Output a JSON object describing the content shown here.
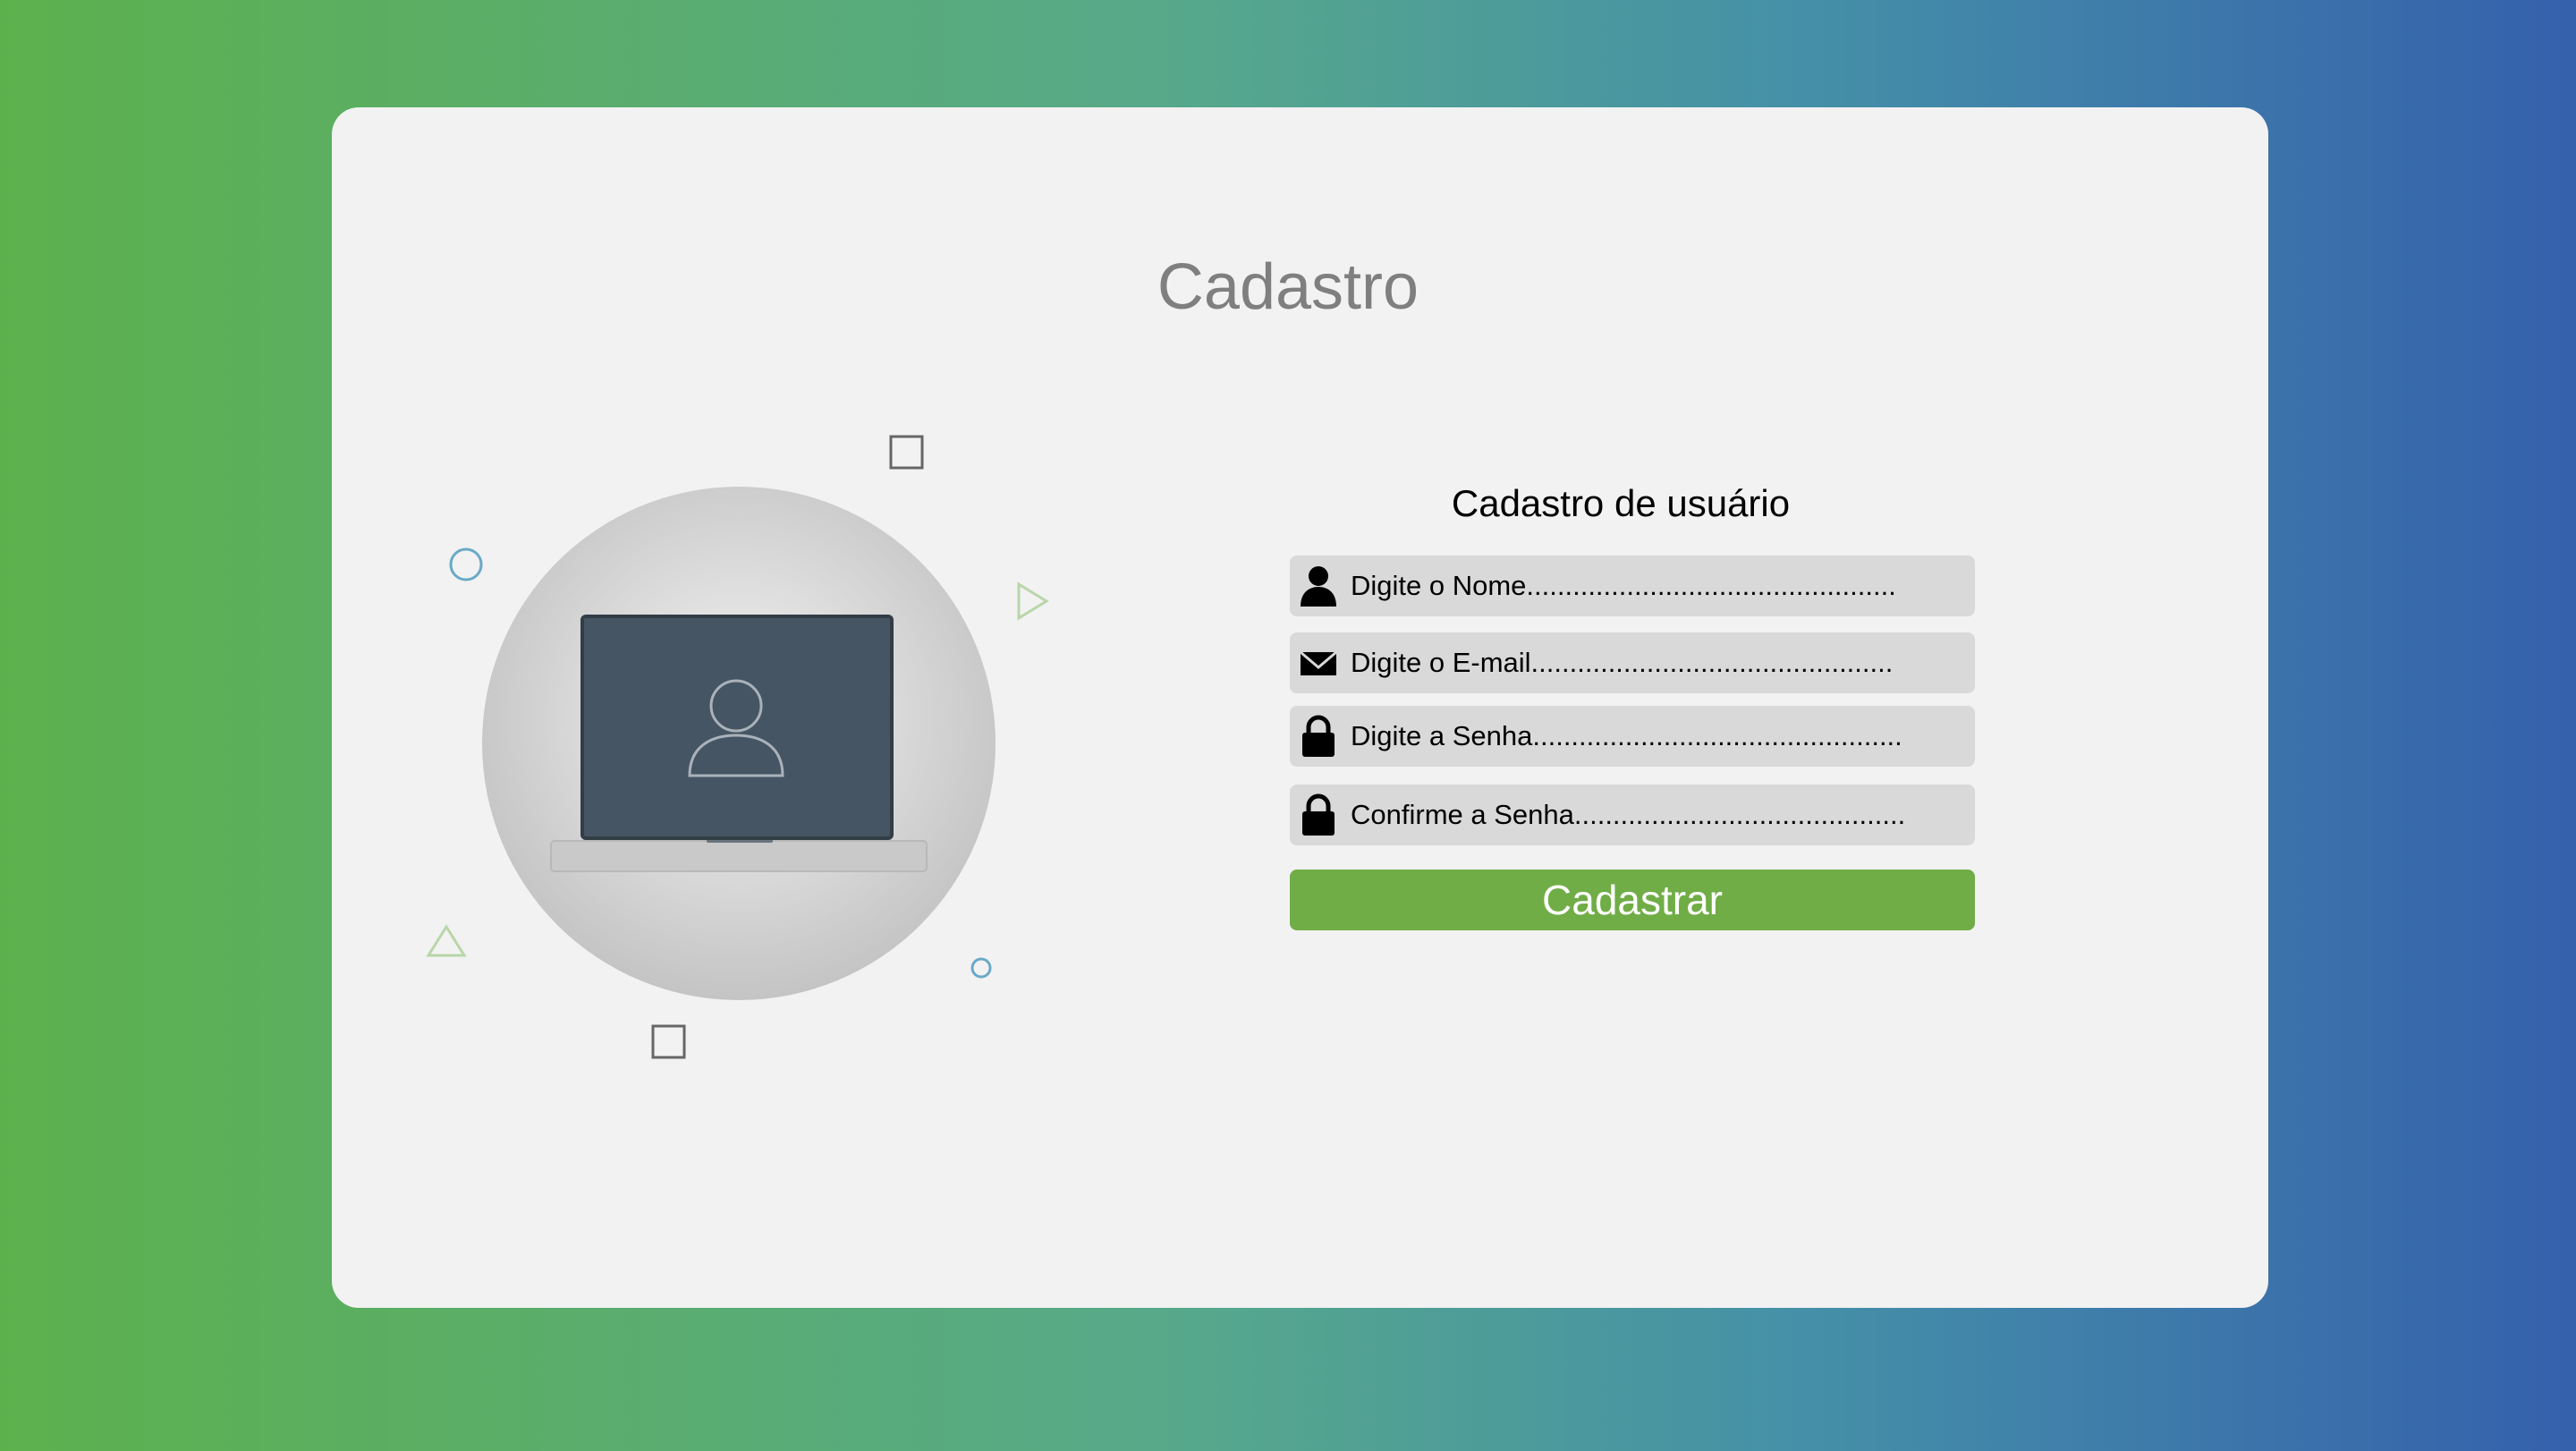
{
  "page": {
    "title": "Cadastro"
  },
  "form": {
    "title": "Cadastro de usuário",
    "fields": [
      {
        "icon": "person-icon",
        "label": "Digite o Nome................................................"
      },
      {
        "icon": "envelope-icon",
        "label": "Digite o E-mail..............................................."
      },
      {
        "icon": "lock-icon",
        "label": "Digite a Senha................................................"
      },
      {
        "icon": "lock-icon",
        "label": "Confirme a Senha..........................................."
      }
    ],
    "submit_label": "Cadastrar"
  },
  "colors": {
    "gradient_start": "#5db14d",
    "gradient_end": "#3560ac",
    "card": "#f2f2f2",
    "field": "#d9d9d9",
    "button": "#70ad47",
    "title": "#7f7f7f"
  }
}
